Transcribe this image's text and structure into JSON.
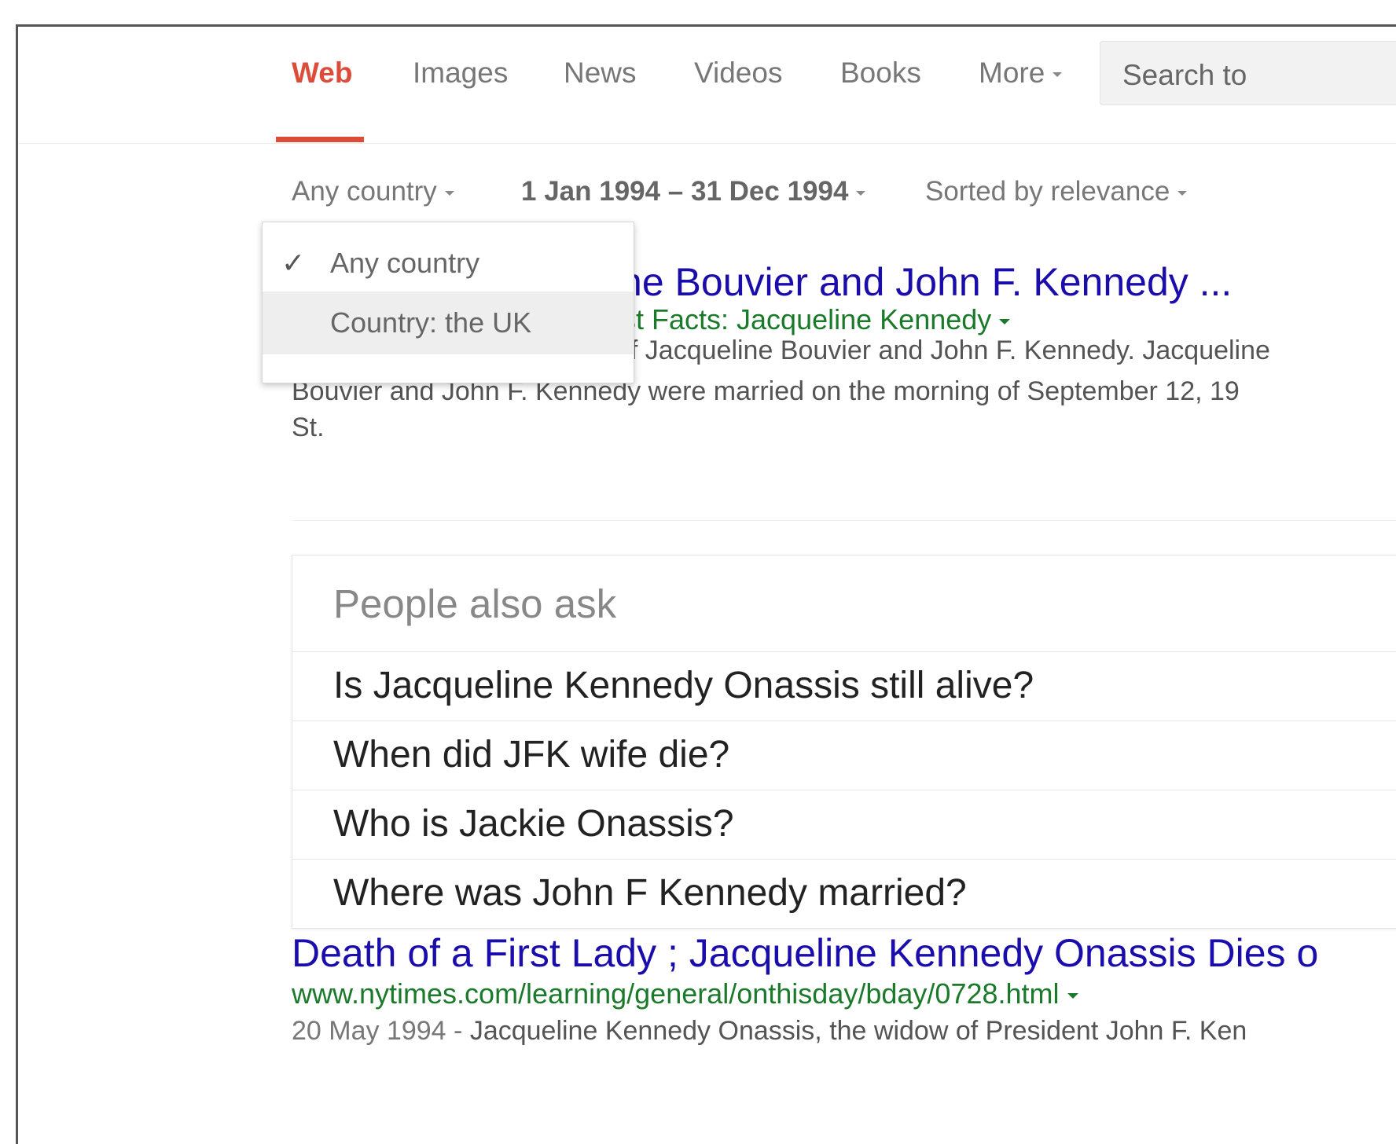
{
  "tabs": [
    {
      "label": "Web",
      "active": true
    },
    {
      "label": "Images"
    },
    {
      "label": "News"
    },
    {
      "label": "Videos"
    },
    {
      "label": "Books"
    },
    {
      "label": "More"
    }
  ],
  "search_tools_label": "Search to",
  "tools": {
    "country": "Any country",
    "date_range": "1 Jan 1994 – 31 Dec 1994",
    "sort": "Sorted by relevance"
  },
  "country_menu": {
    "items": [
      "Any country",
      "Country: the UK"
    ],
    "selected": "Any country",
    "check_glyph": "✓"
  },
  "result1": {
    "title_visible": "eline Bouvier and John F. Kennedy ...",
    "source_visible": "Fast Facts: Jacqueline Kennedy",
    "snippet_line1_visible": "of Jacqueline Bouvier and John F. Kennedy. Jacqueline",
    "snippet_line2": "Bouvier and John F. Kennedy were married on the morning of September 12, 19",
    "snippet_line3": "St."
  },
  "people_also_ask": {
    "heading": "People also ask",
    "questions": [
      "Is Jacqueline Kennedy Onassis still alive?",
      "When did JFK wife die?",
      "Who is Jackie Onassis?",
      "Where was John F Kennedy married?"
    ]
  },
  "result2": {
    "title": "Death of a First Lady ; Jacqueline Kennedy Onassis Dies o",
    "url": "www.nytimes.com/learning/general/onthisday/bday/0728.html",
    "date": "20 May 1994",
    "snippet": "Jacqueline Kennedy Onassis, the widow of President John F. Ken"
  },
  "colors": {
    "active_tab": "#dd4b39",
    "link": "#1a0dab",
    "url_green": "#1a7a2a",
    "snippet_gray": "#545454"
  }
}
